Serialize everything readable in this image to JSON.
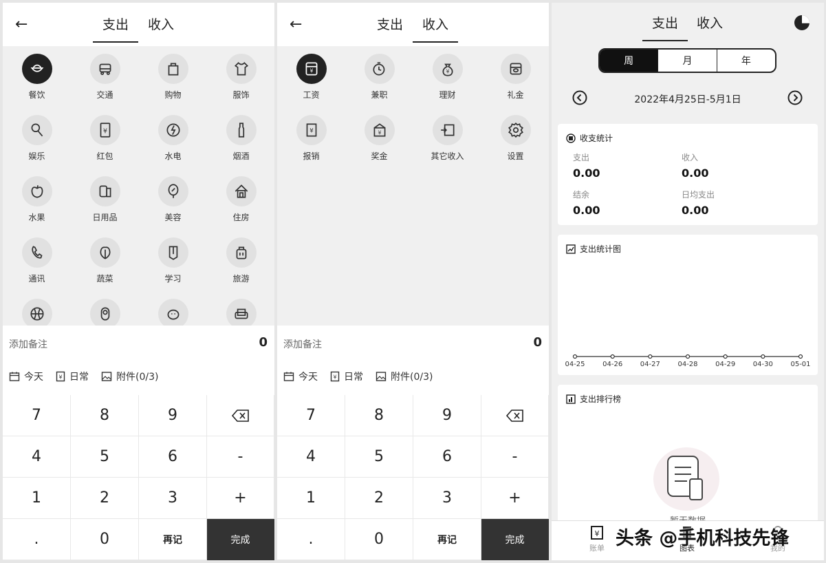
{
  "panel1": {
    "tabs": {
      "expense": "支出",
      "income": "收入"
    },
    "categories": [
      "餐饮",
      "交通",
      "购物",
      "服饰",
      "娱乐",
      "红包",
      "水电",
      "烟酒",
      "水果",
      "日用品",
      "美容",
      "住房",
      "通讯",
      "蔬菜",
      "学习",
      "旅游"
    ],
    "extra_icon_names": [
      "basketball-icon",
      "baby-icon",
      "pet-icon",
      "sofa-icon"
    ],
    "note_placeholder": "添加备注",
    "amount": "0",
    "options": {
      "date": "今天",
      "type": "日常",
      "attach": "附件(0/3)"
    },
    "keys": [
      "7",
      "8",
      "9",
      "4",
      "5",
      "6",
      "-",
      "1",
      "2",
      "3",
      "+",
      ".",
      "0",
      "再记",
      "完成"
    ]
  },
  "panel2": {
    "tabs": {
      "expense": "支出",
      "income": "收入"
    },
    "categories": [
      "工资",
      "兼职",
      "理财",
      "礼金",
      "报销",
      "奖金",
      "其它收入",
      "设置"
    ],
    "note_placeholder": "添加备注",
    "amount": "0",
    "options": {
      "date": "今天",
      "type": "日常",
      "attach": "附件(0/3)"
    },
    "keys": [
      "7",
      "8",
      "9",
      "4",
      "5",
      "6",
      "-",
      "1",
      "2",
      "3",
      "+",
      ".",
      "0",
      "再记",
      "完成"
    ]
  },
  "panel3": {
    "tabs": {
      "expense": "支出",
      "income": "收入"
    },
    "periods": [
      "周",
      "月",
      "年"
    ],
    "date_range": "2022年4月25日-5月1日",
    "summary": {
      "title": "收支统计",
      "expense_label": "支出",
      "expense_value": "0.00",
      "income_label": "收入",
      "income_value": "0.00",
      "balance_label": "结余",
      "balance_value": "0.00",
      "daily_label": "日均支出",
      "daily_value": "0.00"
    },
    "chart_title": "支出统计图",
    "ranking_title": "支出排行榜",
    "empty_text": "暂无数据",
    "nav": {
      "bill": "账单",
      "chart": "图表",
      "mine": "我的"
    }
  },
  "chart_data": {
    "type": "line",
    "categories": [
      "04-25",
      "04-26",
      "04-27",
      "04-28",
      "04-29",
      "04-30",
      "05-01"
    ],
    "values": [
      0,
      0,
      0,
      0,
      0,
      0,
      0
    ]
  },
  "watermark": "头条 @手机科技先锋",
  "colors": {
    "selected": "#222222",
    "icon_bg": "#e1e1e1",
    "done_key": "#333333"
  }
}
